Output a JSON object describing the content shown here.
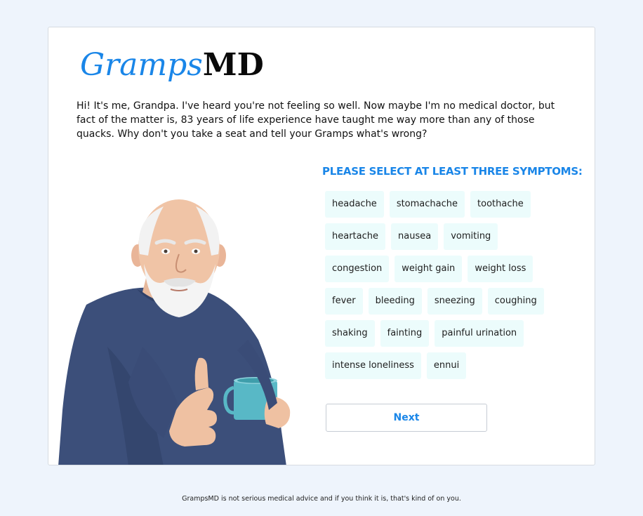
{
  "logo": {
    "first": "Gramps",
    "second": "MD"
  },
  "intro": "Hi! It's me, Grandpa. I've heard you're not feeling so well. Now maybe I'm no medical doctor, but fact of the matter is, 83 years of life experience have taught me way more than any of those quacks. Why don't you take a seat and tell your Gramps what's wrong?",
  "prompt": "Please select at least three symptoms:",
  "symptoms": [
    "headache",
    "stomachache",
    "toothache",
    "heartache",
    "nausea",
    "vomiting",
    "congestion",
    "weight gain",
    "weight loss",
    "fever",
    "bleeding",
    "sneezing",
    "coughing",
    "shaking",
    "fainting",
    "painful urination",
    "intense loneliness",
    "ennui"
  ],
  "next_label": "Next",
  "footer": "GrampsMD is not serious medical advice and if you think it is, that's kind of on you.",
  "colors": {
    "accent": "#1a86e8",
    "chip_bg": "#ecfcfc",
    "page_bg": "#eef4fc"
  },
  "image": "grandpa-thumbs-up-with-mug"
}
